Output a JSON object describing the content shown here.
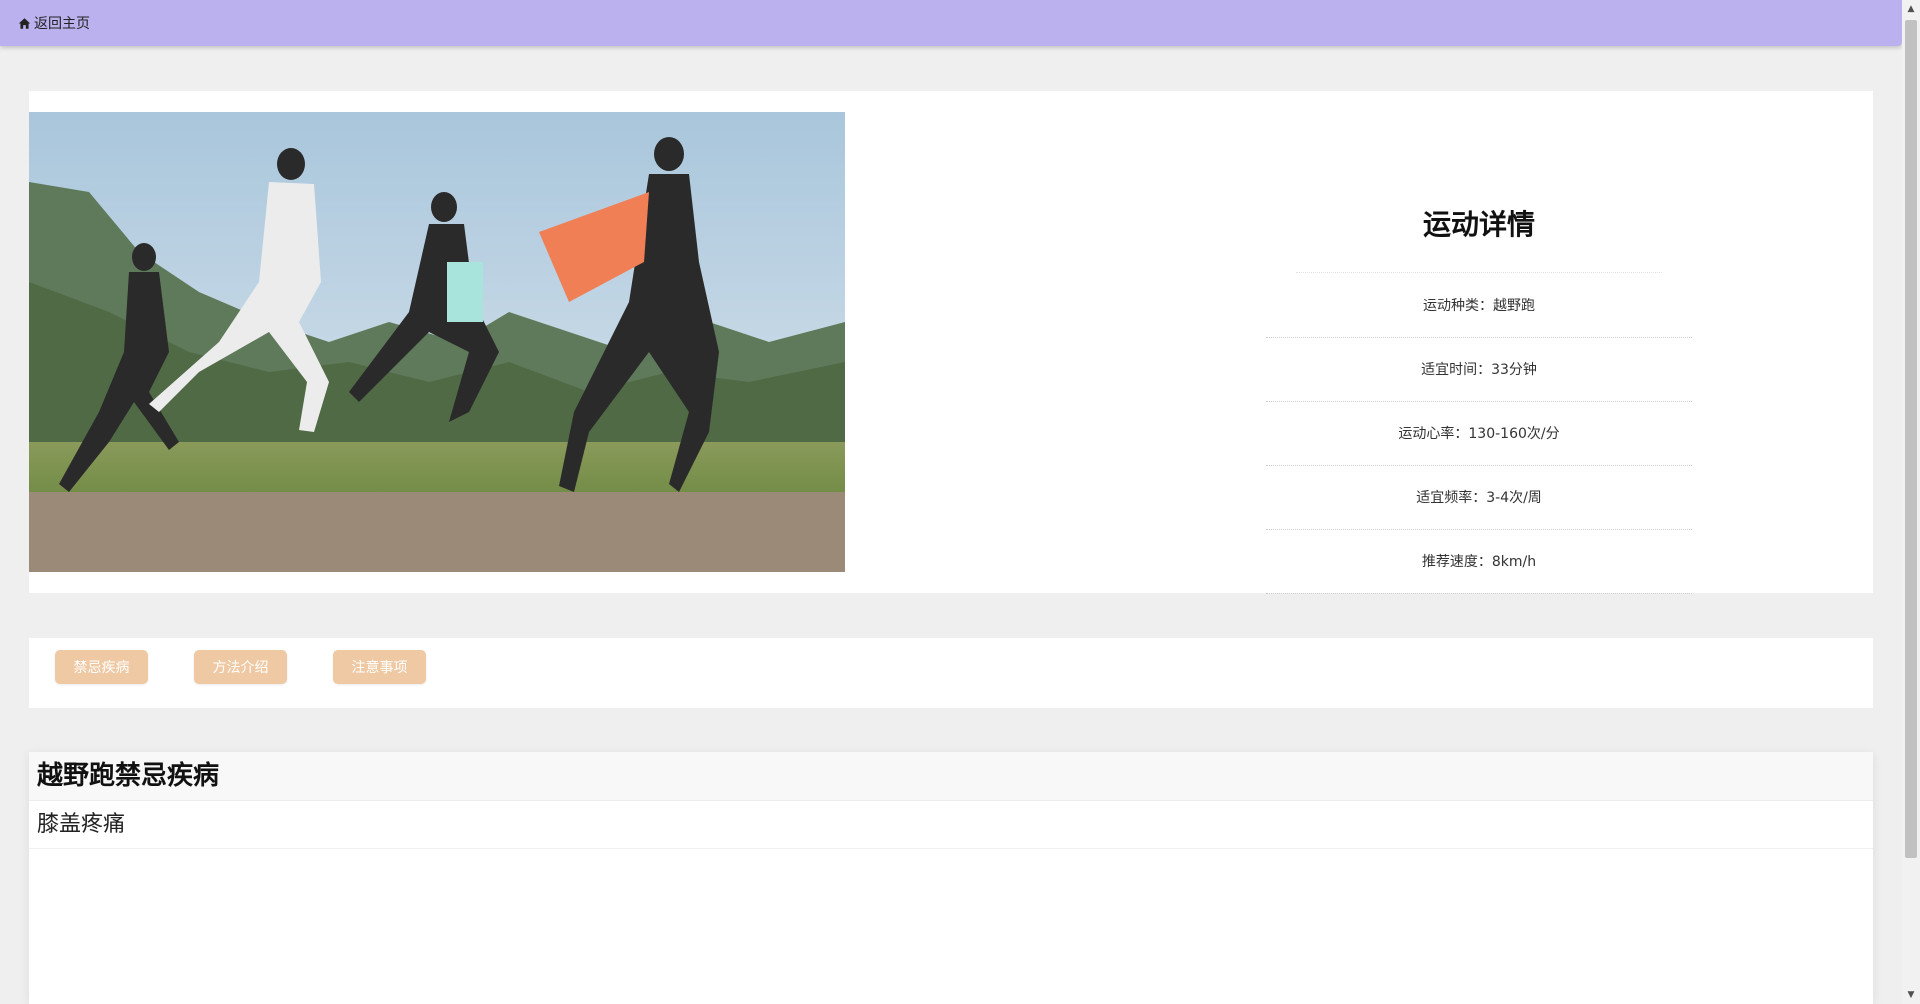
{
  "nav": {
    "home_label": "返回主页",
    "home_icon": "home-icon"
  },
  "detail": {
    "title": "运动详情",
    "image_alt": "",
    "rows": [
      "运动种类：越野跑",
      "适宜时间：33分钟",
      "运动心率：130-160次/分",
      "适宜频率：3-4次/周",
      "推荐速度：8km/h"
    ]
  },
  "tabs": [
    {
      "label": "禁忌疾病"
    },
    {
      "label": "方法介绍"
    },
    {
      "label": "注意事项"
    }
  ],
  "content": {
    "title": "越野跑禁忌疾病",
    "body": "膝盖疼痛"
  },
  "colors": {
    "topbar": "#bbb1ee",
    "tab_button": "#efc9a3",
    "page_background": "#efefef"
  }
}
